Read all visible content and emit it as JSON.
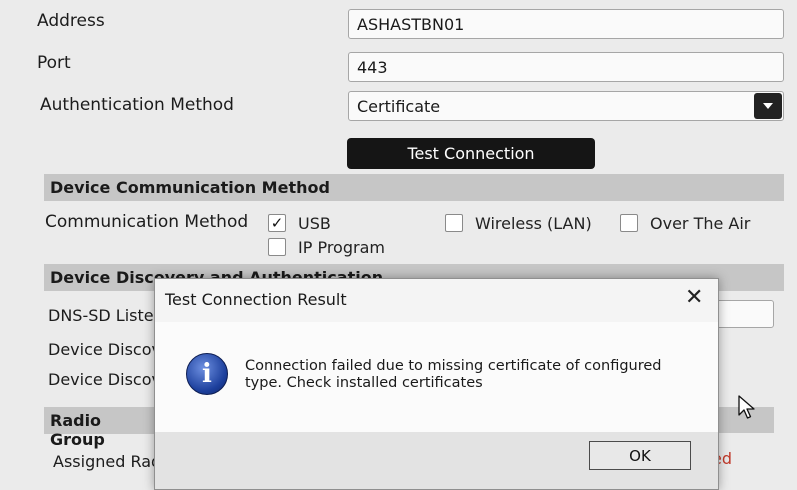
{
  "form": {
    "address_label": "Address",
    "address_value": "ASHASTBN01",
    "port_label": "Port",
    "port_value": "443",
    "auth_label": "Authentication Method",
    "auth_value": "Certificate",
    "test_button": "Test Connection"
  },
  "comm": {
    "section_title": "Device Communication Method",
    "method_label": "Communication Method",
    "options": [
      {
        "label": "USB",
        "checked": true
      },
      {
        "label": "Wireless (LAN)",
        "checked": false
      },
      {
        "label": "Over The Air",
        "checked": false
      },
      {
        "label": "IP Program",
        "checked": false
      }
    ]
  },
  "discovery": {
    "section_title": "Device Discovery and Authentication",
    "rows": [
      "DNS-SD Liste",
      "Device Discov",
      "Device Discov"
    ]
  },
  "radio": {
    "section_title": "Radio Group",
    "assigned_label": "Assigned Rad",
    "status_partial": "ed"
  },
  "dialog": {
    "title": "Test Connection Result",
    "close_glyph": "✕",
    "icon_glyph": "i",
    "message": "Connection failed due to missing certificate of configured type. Check installed certificates",
    "ok_button": "OK"
  },
  "colors": {
    "accent_dark": "#151515",
    "section_bg": "#c6c6c6",
    "info_icon": "#1c3f9c",
    "error_text": "#c23a2a"
  }
}
